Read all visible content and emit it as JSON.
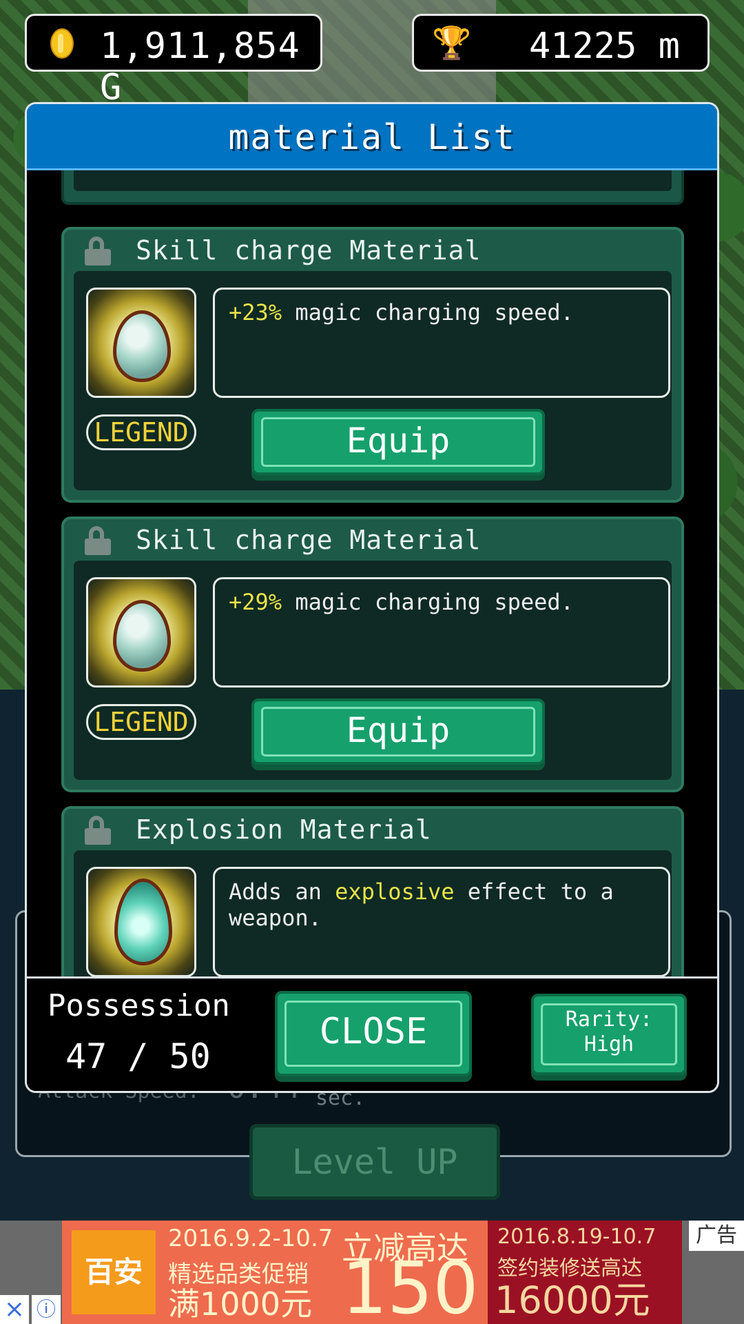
{
  "hud": {
    "gold": "1,911,854 G",
    "distance": "41225 m",
    "coin_icon": "coin-icon",
    "trophy_icon": "trophy-icon"
  },
  "background": {
    "attack_label": "Attack Speed:",
    "attack_value": "0.44",
    "attack_unit": "sec.",
    "level_up": "Level UP"
  },
  "modal": {
    "title": "material List",
    "items": [
      {
        "title": "Skill charge Material",
        "rarity": "LEGEND",
        "desc_highlight": "+23%",
        "desc_rest": " magic charging speed.",
        "button": "Equip",
        "icon": "egg-icon"
      },
      {
        "title": "Skill charge Material",
        "rarity": "LEGEND",
        "desc_highlight": "+29%",
        "desc_rest": " magic charging speed.",
        "button": "Equip",
        "icon": "egg-icon"
      },
      {
        "title": "Explosion Material",
        "desc_pre": "Adds an ",
        "desc_highlight": "explosive",
        "desc_rest": " effect to a weapon.",
        "icon": "drop-icon"
      }
    ],
    "footer": {
      "possession_label": "Possession",
      "possession_value": "47 / 50",
      "close": "CLOSE",
      "rarity_line1": "Rarity:",
      "rarity_line2": "High"
    }
  },
  "ad": {
    "logo": "百安居",
    "date1": "2016.9.2-10.7",
    "promo": "精选品类促销",
    "full": "满1000元",
    "headline": "立减高达",
    "big": "150",
    "date2": "2016.8.19-10.7",
    "sign": "签约装修送高达",
    "amount": "16000元",
    "tag": "广告",
    "close": "×",
    "info": "ⓘ"
  },
  "colors": {
    "accent_blue": "#0073c2",
    "button_green": "#16a06c",
    "highlight_yellow": "#e9e34a",
    "legend_gold": "#f2d23a"
  }
}
